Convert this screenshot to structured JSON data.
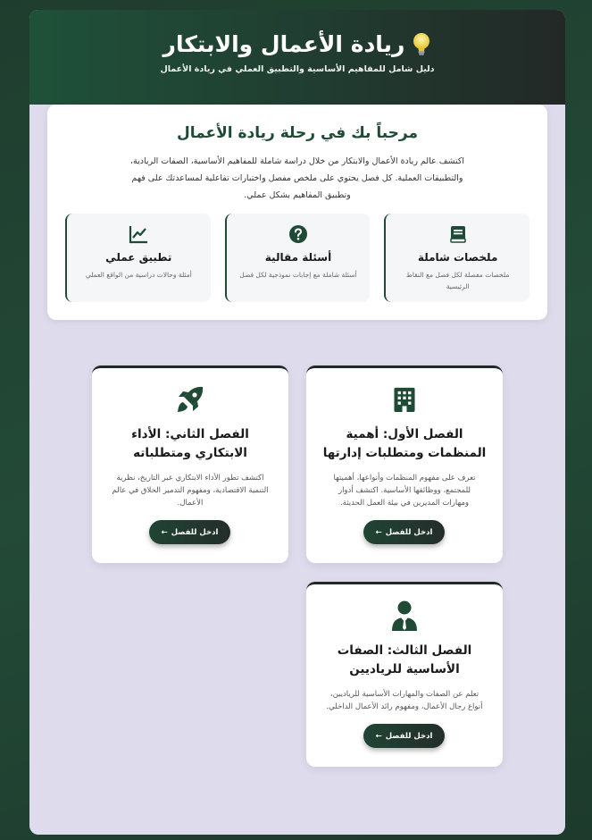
{
  "header": {
    "title": "ريادة الأعمال والابتكار",
    "subtitle": "دليل شامل للمفاهيم الأساسية والتطبيق العملي في ريادة الأعمال",
    "icon": "lightbulb-icon"
  },
  "welcome": {
    "title": "مرحباً بك في رحلة ريادة الأعمال",
    "intro": "اكتشف عالم ريادة الأعمال والابتكار من خلال دراسة شاملة للمفاهيم الأساسية، الصفات الريادية، والتطبيقات العملية. كل فصل يحتوي على ملخص مفصل واختبارات تفاعلية لمساعدتك على فهم وتطبيق المفاهيم بشكل عملي."
  },
  "features": [
    {
      "icon": "book-icon",
      "title": "ملخصات شاملة",
      "desc": "ملخصات مفصلة لكل فصل مع النقاط الرئيسية"
    },
    {
      "icon": "question-circle-icon",
      "title": "أسئلة مقالية",
      "desc": "أسئلة شاملة مع إجابات نموذجية لكل فصل"
    },
    {
      "icon": "line-chart-icon",
      "title": "تطبيق عملي",
      "desc": "أمثلة وحالات دراسية من الواقع العملي"
    }
  ],
  "chapters": [
    {
      "icon": "building-icon",
      "title": "الفصل الأول: أهمية المنظمات ومتطلبات إدارتها",
      "desc": "تعرف على مفهوم المنظمات وأنواعها، أهميتها للمجتمع، ووظائفها الأساسية. اكتشف أدوار ومهارات المديرين في بيئة العمل الحديثة.",
      "button": "ادخل للفصل"
    },
    {
      "icon": "rocket-icon",
      "title": "الفصل الثاني: الأداء الابتكاري ومتطلباته",
      "desc": "اكتشف تطور الأداء الابتكاري عبر التاريخ، نظرية التنمية الاقتصادية، ومفهوم التدمير الخلاق في عالم الأعمال.",
      "button": "ادخل للفصل"
    },
    {
      "icon": "businessman-icon",
      "title": "الفصل الثالث: الصفات الأساسية للرياديين",
      "desc": "تعلم عن الصفات والمهارات الأساسية للرياديين، أنواع رجال الأعمال، ومفهوم رائد الأعمال الداخلي.",
      "button": "ادخل للفصل"
    }
  ],
  "colors": {
    "accent": "#1f4a36",
    "background": "#dedcec"
  }
}
